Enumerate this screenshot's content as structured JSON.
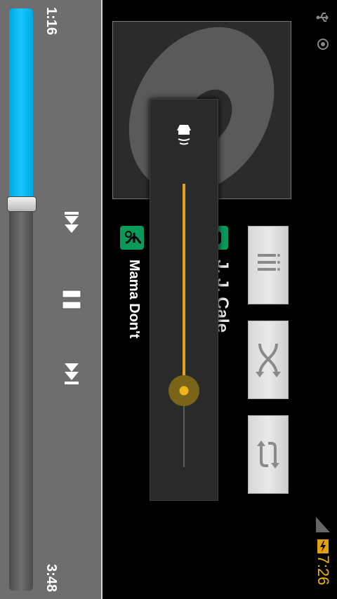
{
  "status_bar": {
    "time": "7:26",
    "icons": [
      "usb-icon",
      "gps-icon",
      "signal-icon",
      "battery-charging-icon"
    ],
    "time_color": "#f3b400"
  },
  "player": {
    "elapsed": "1:16",
    "duration": "3:48",
    "progress_fraction": 0.335,
    "progress_color": "#17c7ff",
    "controls": [
      "previous-icon",
      "pause-icon",
      "next-icon"
    ]
  },
  "track": {
    "title": "Mama Don't",
    "artist": "J. J. Cale",
    "badge_color": "#0a9a5a"
  },
  "side_buttons": [
    "playlist-icon",
    "shuffle-icon",
    "repeat-icon"
  ],
  "volume": {
    "level_fraction": 0.73,
    "accent_color": "#e8a21a"
  }
}
